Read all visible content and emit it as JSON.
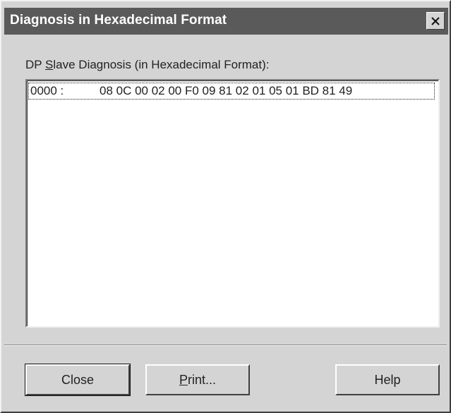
{
  "window": {
    "title": "Diagnosis in Hexadecimal Format",
    "close_icon": "close-icon"
  },
  "section": {
    "label_before": "DP ",
    "label_mnemonic": "S",
    "label_after": "lave Diagnosis (in Hexadecimal Format):"
  },
  "list": {
    "rows": [
      {
        "address": "0000 :",
        "bytes": "08 0C 00 02 00 F0 09 81 02 01 05 01 BD 81 49"
      }
    ]
  },
  "buttons": {
    "close_label": "Close",
    "print_mnemonic": "P",
    "print_rest": "rint...",
    "help_label": "Help"
  },
  "colors": {
    "titlebar": "#5a5a5a",
    "dialog_face": "#d4d4d4",
    "list_background": "#ffffff"
  }
}
